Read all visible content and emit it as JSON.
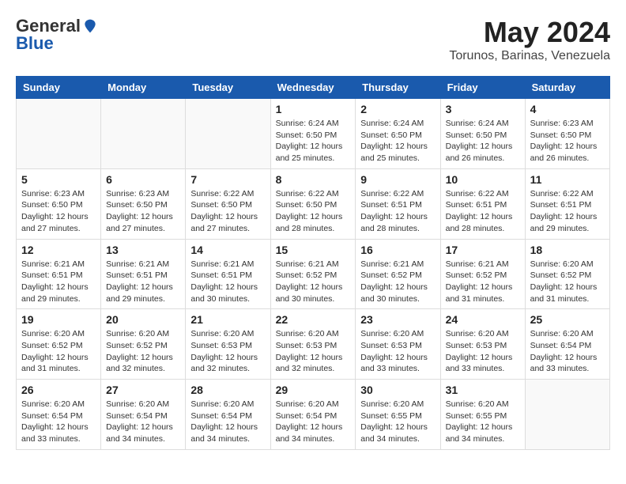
{
  "logo": {
    "general": "General",
    "blue": "Blue"
  },
  "title": {
    "month_year": "May 2024",
    "location": "Torunos, Barinas, Venezuela"
  },
  "weekdays": [
    "Sunday",
    "Monday",
    "Tuesday",
    "Wednesday",
    "Thursday",
    "Friday",
    "Saturday"
  ],
  "weeks": [
    [
      {
        "day": "",
        "info": ""
      },
      {
        "day": "",
        "info": ""
      },
      {
        "day": "",
        "info": ""
      },
      {
        "day": "1",
        "info": "Sunrise: 6:24 AM\nSunset: 6:50 PM\nDaylight: 12 hours\nand 25 minutes."
      },
      {
        "day": "2",
        "info": "Sunrise: 6:24 AM\nSunset: 6:50 PM\nDaylight: 12 hours\nand 25 minutes."
      },
      {
        "day": "3",
        "info": "Sunrise: 6:24 AM\nSunset: 6:50 PM\nDaylight: 12 hours\nand 26 minutes."
      },
      {
        "day": "4",
        "info": "Sunrise: 6:23 AM\nSunset: 6:50 PM\nDaylight: 12 hours\nand 26 minutes."
      }
    ],
    [
      {
        "day": "5",
        "info": "Sunrise: 6:23 AM\nSunset: 6:50 PM\nDaylight: 12 hours\nand 27 minutes."
      },
      {
        "day": "6",
        "info": "Sunrise: 6:23 AM\nSunset: 6:50 PM\nDaylight: 12 hours\nand 27 minutes."
      },
      {
        "day": "7",
        "info": "Sunrise: 6:22 AM\nSunset: 6:50 PM\nDaylight: 12 hours\nand 27 minutes."
      },
      {
        "day": "8",
        "info": "Sunrise: 6:22 AM\nSunset: 6:50 PM\nDaylight: 12 hours\nand 28 minutes."
      },
      {
        "day": "9",
        "info": "Sunrise: 6:22 AM\nSunset: 6:51 PM\nDaylight: 12 hours\nand 28 minutes."
      },
      {
        "day": "10",
        "info": "Sunrise: 6:22 AM\nSunset: 6:51 PM\nDaylight: 12 hours\nand 28 minutes."
      },
      {
        "day": "11",
        "info": "Sunrise: 6:22 AM\nSunset: 6:51 PM\nDaylight: 12 hours\nand 29 minutes."
      }
    ],
    [
      {
        "day": "12",
        "info": "Sunrise: 6:21 AM\nSunset: 6:51 PM\nDaylight: 12 hours\nand 29 minutes."
      },
      {
        "day": "13",
        "info": "Sunrise: 6:21 AM\nSunset: 6:51 PM\nDaylight: 12 hours\nand 29 minutes."
      },
      {
        "day": "14",
        "info": "Sunrise: 6:21 AM\nSunset: 6:51 PM\nDaylight: 12 hours\nand 30 minutes."
      },
      {
        "day": "15",
        "info": "Sunrise: 6:21 AM\nSunset: 6:52 PM\nDaylight: 12 hours\nand 30 minutes."
      },
      {
        "day": "16",
        "info": "Sunrise: 6:21 AM\nSunset: 6:52 PM\nDaylight: 12 hours\nand 30 minutes."
      },
      {
        "day": "17",
        "info": "Sunrise: 6:21 AM\nSunset: 6:52 PM\nDaylight: 12 hours\nand 31 minutes."
      },
      {
        "day": "18",
        "info": "Sunrise: 6:20 AM\nSunset: 6:52 PM\nDaylight: 12 hours\nand 31 minutes."
      }
    ],
    [
      {
        "day": "19",
        "info": "Sunrise: 6:20 AM\nSunset: 6:52 PM\nDaylight: 12 hours\nand 31 minutes."
      },
      {
        "day": "20",
        "info": "Sunrise: 6:20 AM\nSunset: 6:52 PM\nDaylight: 12 hours\nand 32 minutes."
      },
      {
        "day": "21",
        "info": "Sunrise: 6:20 AM\nSunset: 6:53 PM\nDaylight: 12 hours\nand 32 minutes."
      },
      {
        "day": "22",
        "info": "Sunrise: 6:20 AM\nSunset: 6:53 PM\nDaylight: 12 hours\nand 32 minutes."
      },
      {
        "day": "23",
        "info": "Sunrise: 6:20 AM\nSunset: 6:53 PM\nDaylight: 12 hours\nand 33 minutes."
      },
      {
        "day": "24",
        "info": "Sunrise: 6:20 AM\nSunset: 6:53 PM\nDaylight: 12 hours\nand 33 minutes."
      },
      {
        "day": "25",
        "info": "Sunrise: 6:20 AM\nSunset: 6:54 PM\nDaylight: 12 hours\nand 33 minutes."
      }
    ],
    [
      {
        "day": "26",
        "info": "Sunrise: 6:20 AM\nSunset: 6:54 PM\nDaylight: 12 hours\nand 33 minutes."
      },
      {
        "day": "27",
        "info": "Sunrise: 6:20 AM\nSunset: 6:54 PM\nDaylight: 12 hours\nand 34 minutes."
      },
      {
        "day": "28",
        "info": "Sunrise: 6:20 AM\nSunset: 6:54 PM\nDaylight: 12 hours\nand 34 minutes."
      },
      {
        "day": "29",
        "info": "Sunrise: 6:20 AM\nSunset: 6:54 PM\nDaylight: 12 hours\nand 34 minutes."
      },
      {
        "day": "30",
        "info": "Sunrise: 6:20 AM\nSunset: 6:55 PM\nDaylight: 12 hours\nand 34 minutes."
      },
      {
        "day": "31",
        "info": "Sunrise: 6:20 AM\nSunset: 6:55 PM\nDaylight: 12 hours\nand 34 minutes."
      },
      {
        "day": "",
        "info": ""
      }
    ]
  ]
}
